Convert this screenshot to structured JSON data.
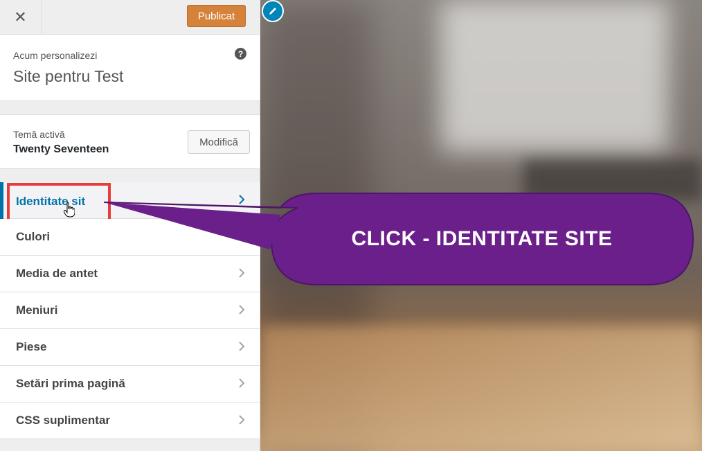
{
  "topbar": {
    "close_icon": "close-icon",
    "close_glyph": "✕",
    "publish_label": "Publicat",
    "publish_color": "#d5823b"
  },
  "info": {
    "subtitle": "Acum personalizezi",
    "title": "Site pentru Test",
    "help_glyph": "?"
  },
  "theme": {
    "subtitle": "Temă activă",
    "name": "Twenty Seventeen",
    "modify_label": "Modifică"
  },
  "menu": {
    "items": [
      {
        "label": "Identitate sit",
        "active": true
      },
      {
        "label": "Culori"
      },
      {
        "label": "Media de antet"
      },
      {
        "label": "Meniuri"
      },
      {
        "label": "Piese"
      },
      {
        "label": "Setări prima pagină"
      },
      {
        "label": "CSS suplimentar"
      }
    ]
  },
  "callout": {
    "text": "CLICK - IDENTITATE SITE",
    "color": "#6a1f8a"
  },
  "colors": {
    "accent": "#0073aa",
    "highlight": "#e73c3c"
  }
}
